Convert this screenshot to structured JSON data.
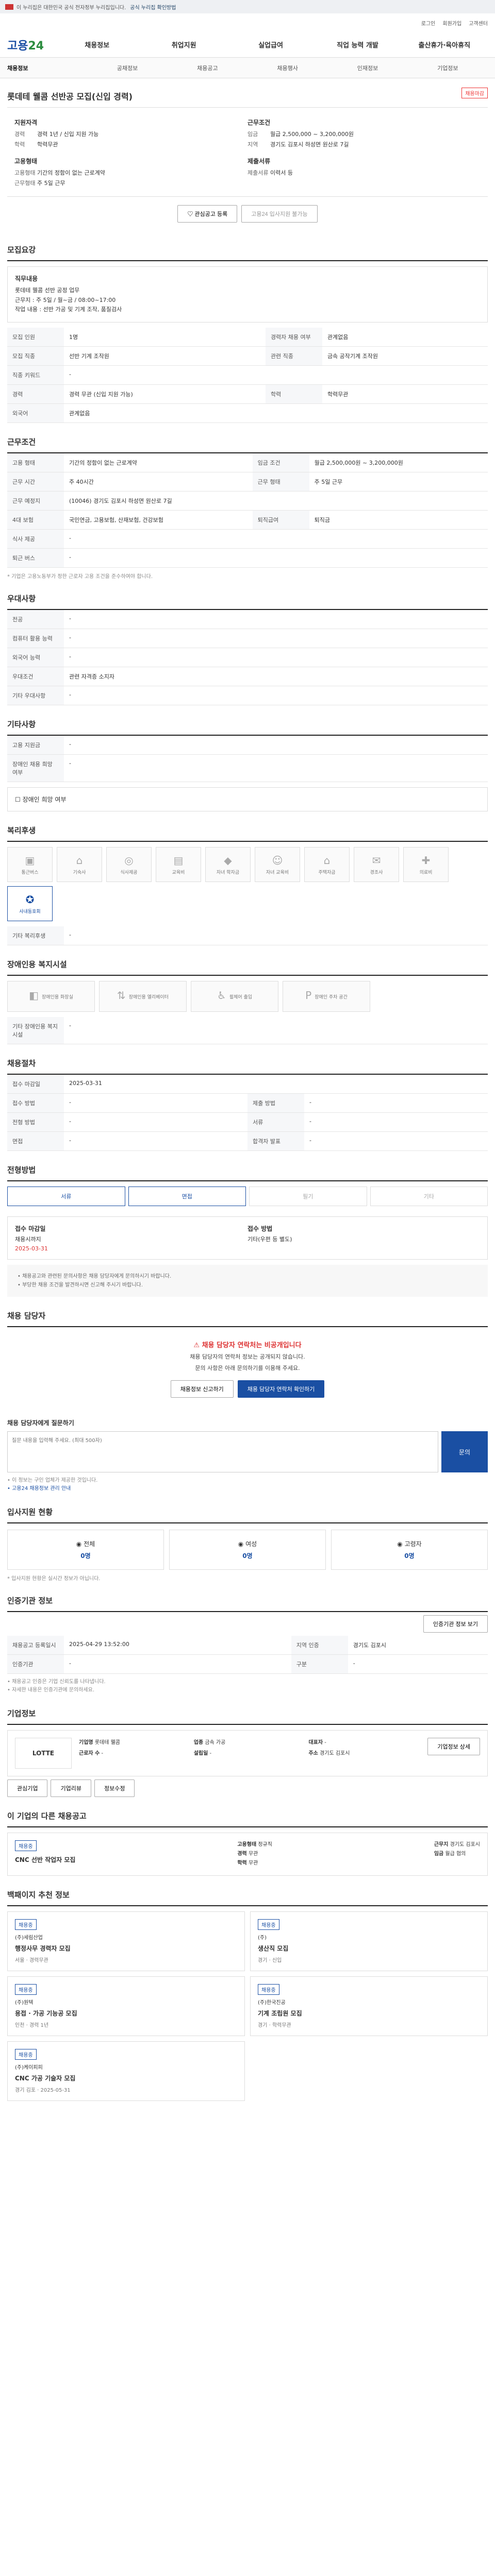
{
  "gov": {
    "text": "이 누리집은 대한민국 공식 전자정부 누리집입니다.",
    "link": "공식 누리집 확인방법"
  },
  "top": [
    "로그인",
    "회원가입",
    "고객센터"
  ],
  "logo": {
    "a": "고용",
    "b": "24"
  },
  "gnb": [
    "채용정보",
    "취업지원",
    "실업급여",
    "직업 능력 개발",
    "출산휴가·육아휴직"
  ],
  "sub": {
    "first": "채용정보",
    "items": [
      "공채정보",
      "채용공고",
      "채용행사",
      "인재정보",
      "기업정보"
    ]
  },
  "job": {
    "badge": "채용마감",
    "title": "롯데테 웰콤 선반공 모집(신입 경력)",
    "subtitle_left": "지원자격",
    "subtitle_right": "근무조건",
    "left": [
      [
        "경력",
        "경력 1년 / 신입 지원 가능"
      ],
      [
        "학력",
        "학력무관"
      ]
    ],
    "left2_title": "고용형태",
    "left2": [
      [
        "고용형태",
        "기간의 정함이 없는 근로계약"
      ],
      [
        "근무형태",
        "주 5일 근무"
      ]
    ],
    "right": [
      [
        "임금",
        "월급 2,500,000 ~ 3,200,000원"
      ],
      [
        "지역",
        "경기도 김포시 하성면 원산로 7길"
      ]
    ],
    "right2_title": "제출서류",
    "right2": [
      [
        "제출서류",
        "이력서 등"
      ]
    ],
    "btn_like": "관심공고 등록",
    "btn_apply": "고용24 입사지원 불가능"
  },
  "sec": {
    "s1": "모집요강",
    "s2": "근무조건",
    "s3": "우대사항",
    "s4": "기타사항",
    "s5": "복리후생",
    "s6": "장애인용 복지시설",
    "s7": "채용절차",
    "s8": "전형방법",
    "s9": "채용 담당자",
    "s10": "입사지원 현황",
    "s11": "인증기관 정보",
    "s12": "기업정보",
    "s13": "이 기업의 다른 채용공고",
    "s14": "백패이지 추천 정보"
  },
  "recruit": {
    "desc_label": "직무내용",
    "desc": "롯데테 웰콤 선반 공정 업무\n근무지 : 주 5일 / 월~금 / 08:00~17:00\n작업 내용 : 선반 가공 및 기계 조작, 품질검사",
    "rows": [
      [
        "모집 인원",
        "1명",
        "경력자 채용 여부",
        "관계없음"
      ],
      [
        "모집 직종",
        "선반 기계 조작원",
        "관련 직종",
        "금속 공작기계 조작원"
      ],
      [
        "직종 키워드",
        "-",
        "",
        ""
      ],
      [
        "경력",
        "경력 무관 (신입 지원 가능)",
        "학력",
        "학력무관"
      ],
      [
        "외국어",
        "관계없음",
        "",
        ""
      ]
    ]
  },
  "cond": {
    "rows": [
      [
        "고용 형태",
        "기간의 정함이 없는 근로계약",
        "임금 조건",
        "월급 2,500,000원 ~ 3,200,000원"
      ],
      [
        "근무 시간",
        "주 40시간",
        "근무 형태",
        "주 5일 근무"
      ],
      [
        "근무 예정지",
        "(10046) 경기도 김포시 하성면 원산로 7길",
        "",
        ""
      ],
      [
        "4대 보험",
        "국민연금, 고용보험, 산재보험, 건강보험",
        "퇴직급여",
        "퇴직금"
      ],
      [
        "식사 제공",
        "-",
        "",
        ""
      ],
      [
        "퇴근 버스",
        "-",
        "",
        ""
      ]
    ],
    "note": "* 기업은 고용노동부가 정한 근로자 고용 조건을 준수하여야 합니다."
  },
  "pref": {
    "rows": [
      [
        "전공",
        "-"
      ],
      [
        "컴퓨터 활용 능력",
        "-"
      ],
      [
        "외국어 능력",
        "-"
      ],
      [
        "우대조건",
        "관련 자격증 소지자"
      ],
      [
        "기타 우대사항",
        "-"
      ]
    ]
  },
  "etc": {
    "rows": [
      [
        "고용 지원금",
        "-"
      ],
      [
        "장애인 채용 희망 여부",
        "-"
      ]
    ],
    "check": "장애인 희망 여부"
  },
  "welfare": {
    "items": [
      "통근버스",
      "기숙사",
      "식사제공",
      "교육비",
      "자녀 학자금",
      "자녀 교육비",
      "주택자금",
      "경조사",
      "의료비",
      "사내동호회"
    ],
    "active_label": "사내동호회",
    "extra_label": "기타 복리후생",
    "extra": "-"
  },
  "disab": {
    "items": [
      "장애인용 화장실",
      "장애인용 엘리베이터",
      "휠체어 출입",
      "장애인 주차 공간"
    ],
    "extra_label": "기타 장애인용 복지시설",
    "extra": "-"
  },
  "proc": {
    "rows": [
      [
        "접수 마감일",
        "2025-03-31",
        "",
        ""
      ],
      [
        "접수 방법",
        "-",
        "제출 방법",
        "-"
      ],
      [
        "전형 방법",
        "-",
        "서류",
        "-"
      ],
      [
        "면접",
        "-",
        "합격자 발표",
        "-"
      ]
    ]
  },
  "method": {
    "tabs": [
      "서류",
      "면접",
      "필기",
      "기타"
    ],
    "left": "접수 마감일",
    "left_v": "채용시까지",
    "right": "접수 방법",
    "right_v": "기타(우편 등 별도)",
    "apply": "2025-03-31"
  },
  "notice": [
    "• 채용공고와 관련된 문의사항은 채용 담당자에게 문의하시기 바랍니다.",
    "• 부당한 채용 조건을 발견하시면 신고해 주시기 바랍니다."
  ],
  "contact": {
    "warn": "채용 담당자 연락처는 비공개입니다",
    "p1": "채용 담당자의 연락처 정보는 공개되지 않습니다.",
    "p2": "문의 사항은 아래 문의하기를 이용해 주세요.",
    "b1": "채용정보 신고하기",
    "b2": "채용 담당자 연락처 확인하기",
    "q_label": "채용 담당자에게 질문하기",
    "q_ph": "질문 내용을 입력해 주세요. (최대 500자)",
    "q_btn": "문의",
    "notes": [
      "• 이 정보는 구인 업체가 제공한 것입니다.",
      "• 고용24 채용정보 관리 안내"
    ]
  },
  "status": {
    "items": [
      [
        "전체",
        "0명"
      ],
      [
        "여성",
        "0명"
      ],
      [
        "고령자",
        "0명"
      ]
    ],
    "note": "* 입사지원 현황은 실시간 정보가 아닙니다."
  },
  "cert": {
    "btn": "인증기관 정보 보기",
    "rows": [
      [
        "채용공고 등록일시",
        "2025-04-29 13:52:00",
        "지역 인증",
        "경기도 김포시"
      ],
      [
        "인증기관",
        "-",
        "구분",
        "-"
      ]
    ],
    "notes": [
      "• 채용공고 인증은 기업 신뢰도를 나타냅니다.",
      "• 자세한 내용은 인증기관에 문의하세요."
    ]
  },
  "corp": {
    "logo": "LOTTE",
    "btn": "기업정보 상세",
    "info": [
      [
        "기업명",
        "롯데테 웰콤"
      ],
      [
        "업종",
        "금속 가공"
      ],
      [
        "대표자",
        "-"
      ],
      [
        "근로자 수",
        "-"
      ],
      [
        "설립일",
        "-"
      ],
      [
        "주소",
        "경기도 김포시"
      ]
    ],
    "tags": [
      "관심기업",
      "기업리뷰",
      "정보수정"
    ]
  },
  "other": {
    "badge": "채용중",
    "title": "CNC 선반 작업자 모집",
    "items": [
      [
        "고용형태",
        "정규직"
      ],
      [
        "경력",
        "무관"
      ],
      [
        "학력",
        "무관"
      ],
      [
        "근무지",
        "경기도 김포시"
      ],
      [
        "임금",
        "월급 협의"
      ]
    ]
  },
  "rec": [
    {
      "co": "(주)세림산업",
      "t": "행정사무 경력자 모집",
      "m1": "서울",
      "m2": "경력무관"
    },
    {
      "co": "(주)",
      "t": "생산직 모집",
      "m1": "경기",
      "m2": "신입"
    },
    {
      "co": "(주)원텍",
      "t": "용접 · 가공 기능공 모집",
      "m1": "인천",
      "m2": "경력 1년"
    },
    {
      "co": "(주)한국진공",
      "t": "기계 조립원 모집",
      "m1": "경기",
      "m2": "학력무관"
    },
    {
      "co": "(주)케이피피",
      "t": "CNC 가공 기술자 모집",
      "m1": "경기 김포",
      "m2": "2025-05-31"
    }
  ]
}
